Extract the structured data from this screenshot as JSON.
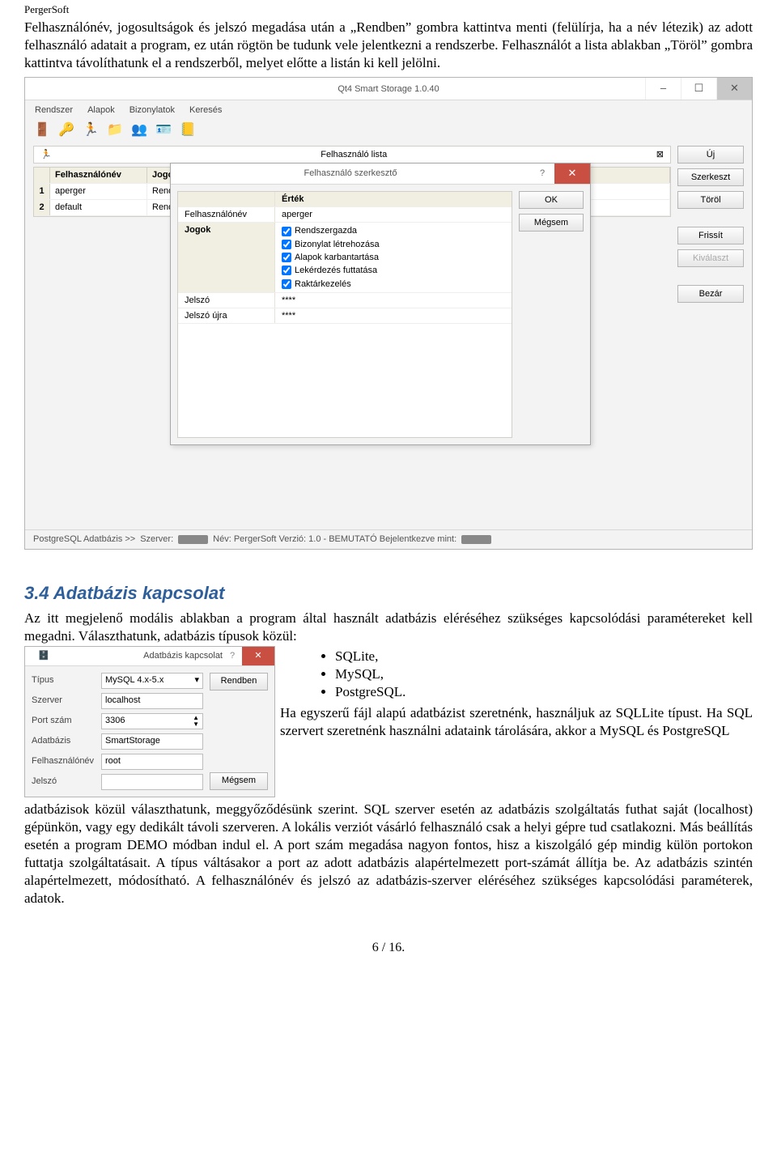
{
  "doc": {
    "header": "PergerSoft",
    "intro": "Felhasználónév, jogosultságok és jelszó megadása után a „Rendben” gombra kattintva menti (felülírja, ha a név létezik) az adott felhasználó adatait a program, ez után rögtön be tudunk vele jelentkezni a rendszerbe. Felhasználót a lista ablakban „Töröl” gombra kattintva távolíthatunk el a rendszerből, melyet előtte a listán ki kell jelölni.",
    "section_title": "3.4  Adatbázis kapcsolat",
    "body1": "Az itt megjelenő modális ablakban a program által használt adatbázis eléréséhez szükséges kapcsolódási paramétereket kell megadni. Választhatunk, adatbázis típusok közül:",
    "bullets": [
      "SQLite,",
      "MySQL,",
      "PostgreSQL."
    ],
    "body2a": "Ha egyszerű fájl alapú adatbázist szeretnénk, használjuk az SQLLite típust. Ha SQL szervert szeretnénk használni adataink tárolására, akkor a MySQL és PostgreSQL",
    "body2b": "adatbázisok közül választhatunk, meggyőződésünk szerint. SQL szerver esetén az adatbázis szolgáltatás futhat saját (localhost) gépünkön, vagy egy dedikált távoli szerveren. A lokális verziót vásárló felhasználó csak a helyi gépre tud csatlakozni. Más beállítás esetén a program DEMO módban indul el. A port szám megadása nagyon fontos, hisz a kiszolgáló gép mindig külön portokon futtatja szolgáltatásait. A típus váltásakor a port az adott adatbázis alapértelmezett port-számát állítja be. Az adatbázis szintén alapértelmezett, módosítható. A felhasználónév és jelszó az adatbázis-szerver eléréséhez szükséges kapcsolódási paraméterek, adatok.",
    "footer": "6 / 16."
  },
  "qt": {
    "title": "Qt4 Smart Storage 1.0.40",
    "menubar": [
      "Rendszer",
      "Alapok",
      "Bizonylatok",
      "Keresés"
    ],
    "subtab_label": "Felhasználó lista",
    "columns": {
      "user": "Felhasználónév",
      "rights": "Jogok"
    },
    "rows": [
      {
        "n": "1",
        "user": "aperger",
        "rights": "Rendszergazda, Bizonylat létrehozása, Alapok karbantartása, Lekérdezés futtatása, Raktárkezelés"
      },
      {
        "n": "2",
        "user": "default",
        "rights": "Rendszergazda"
      }
    ],
    "buttons": {
      "new": "Új",
      "edit": "Szerkeszt",
      "del": "Töröl",
      "refresh": "Frissít",
      "select": "Kiválaszt",
      "close": "Bezár"
    },
    "status": {
      "a": "PostgreSQL Adatbázis >>",
      "b": "Szerver:",
      "c": "Név: PergerSoft  Verzió: 1.0 - BEMUTATÓ  Bejelentkezve mint:"
    }
  },
  "editor": {
    "title": "Felhasználó szerkesztő",
    "col_val": "Érték",
    "rows": {
      "user_lbl": "Felhasználónév",
      "user_val": "aperger",
      "rights_lbl": "Jogok",
      "rights": [
        "Rendszergazda",
        "Bizonylat létrehozása",
        "Alapok karbantartása",
        "Lekérdezés futtatása",
        "Raktárkezelés"
      ],
      "pw_lbl": "Jelszó",
      "pw_val": "****",
      "pw2_lbl": "Jelszó újra",
      "pw2_val": "****"
    },
    "ok": "OK",
    "cancel": "Mégsem"
  },
  "db": {
    "title": "Adatbázis kapcsolat",
    "labels": {
      "type": "Típus",
      "server": "Szerver",
      "port": "Port szám",
      "db": "Adatbázis",
      "user": "Felhasználónév",
      "pw": "Jelszó"
    },
    "values": {
      "type": "MySQL 4.x-5.x",
      "server": "localhost",
      "port": "3306",
      "db": "SmartStorage",
      "user": "root",
      "pw": ""
    },
    "ok": "Rendben",
    "cancel": "Mégsem"
  }
}
